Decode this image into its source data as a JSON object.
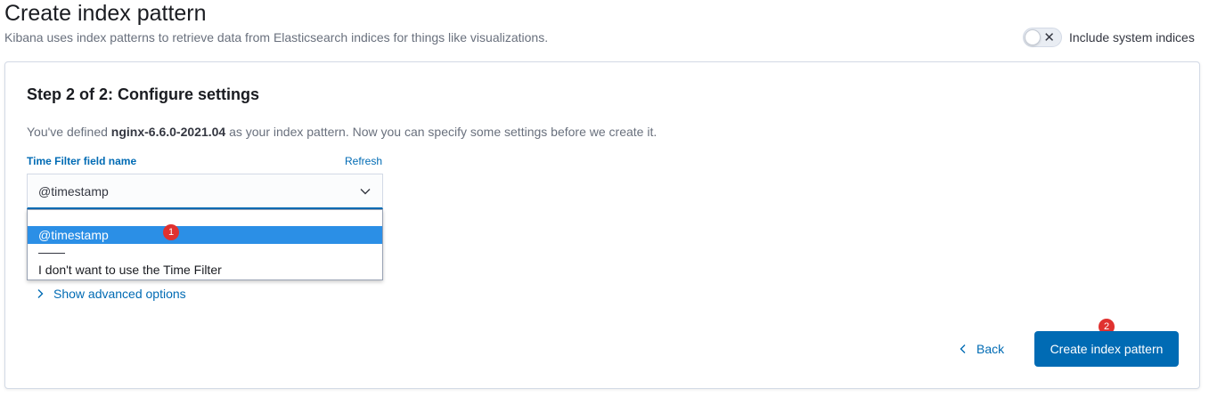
{
  "header": {
    "title": "Create index pattern",
    "description": "Kibana uses index patterns to retrieve data from Elasticsearch indices for things like visualizations.",
    "system_toggle": {
      "label": "Include system indices",
      "state_icon": "close-icon",
      "state_glyph": "✕",
      "checked": false
    }
  },
  "step": {
    "title": "Step 2 of 2: Configure settings",
    "defined_prefix": "You've defined ",
    "index_pattern": "nginx-6.6.0-2021.04",
    "defined_suffix": " as your index pattern. Now you can specify some settings before we create it."
  },
  "time_filter": {
    "label": "Time Filter field name",
    "refresh_label": "Refresh",
    "selected_value": "@timestamp",
    "options": [
      {
        "label": "@timestamp",
        "selected": true
      },
      {
        "label": "I don't want to use the Time Filter",
        "selected": false
      }
    ]
  },
  "advanced": {
    "label": "Show advanced options"
  },
  "footer": {
    "back_label": "Back",
    "create_label": "Create index pattern"
  },
  "annotations": {
    "badge_1": "1",
    "badge_2": "2"
  },
  "colors": {
    "primary": "#006bb4",
    "selected_option": "#2b8fe6",
    "badge": "#e0312f"
  }
}
